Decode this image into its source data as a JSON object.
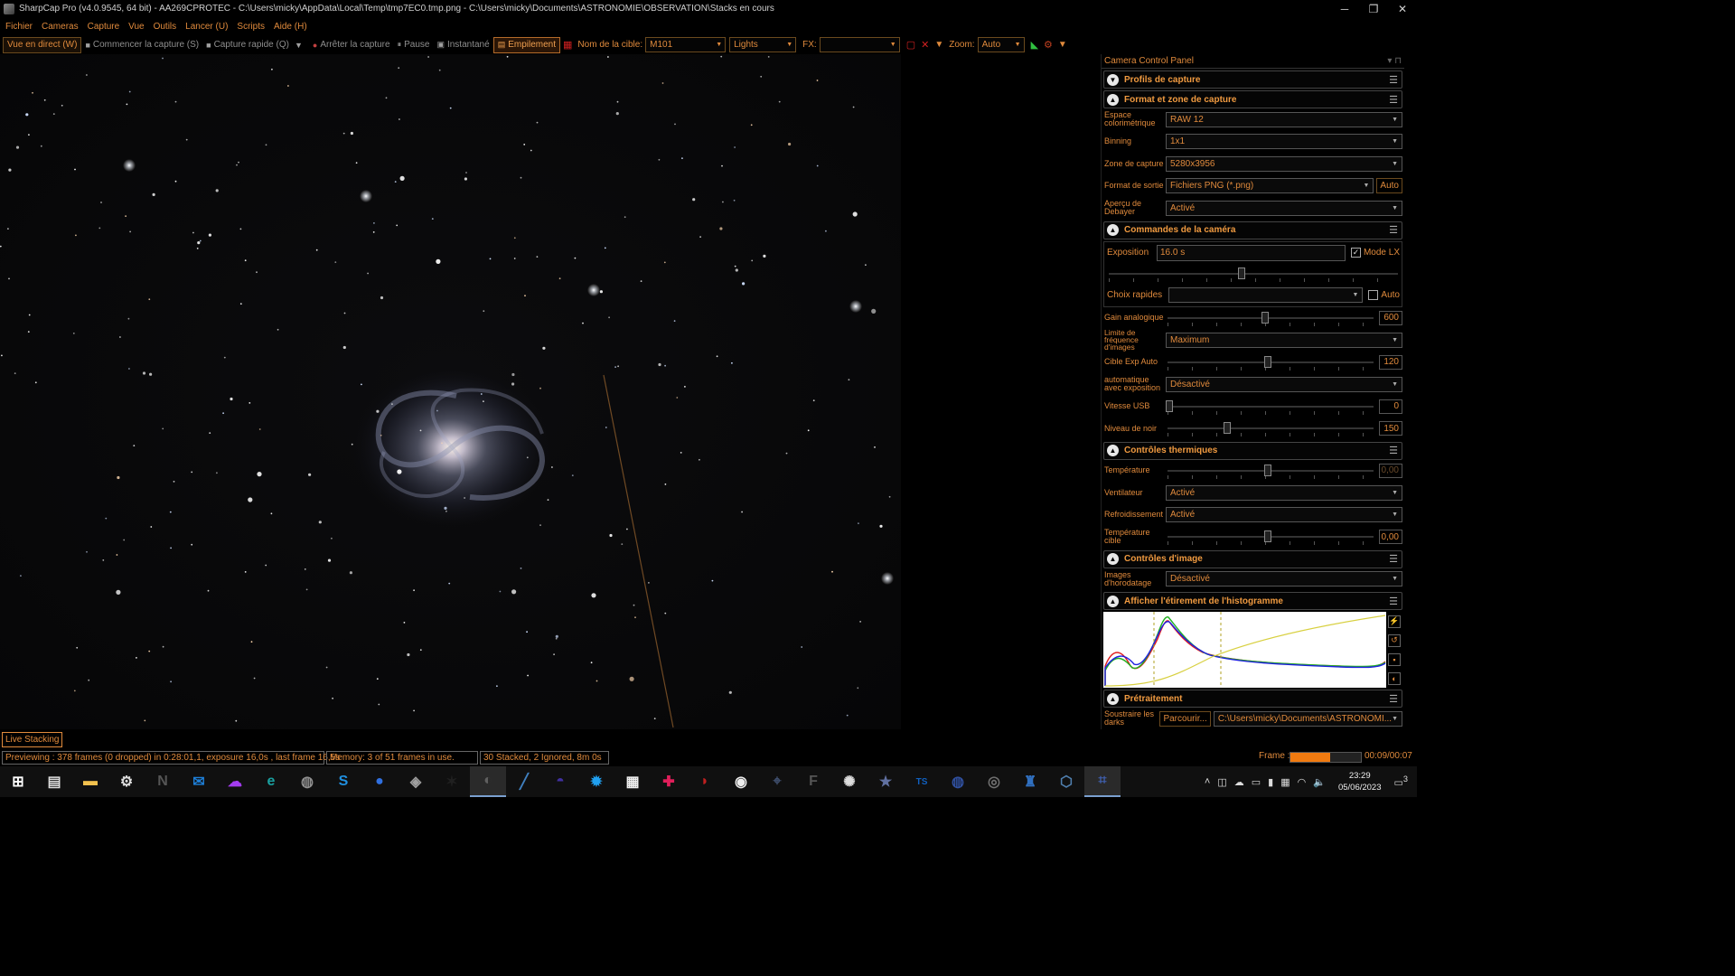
{
  "titlebar": {
    "title": "SharpCap Pro (v4.0.9545, 64 bit) - AA269CPROTEC - C:\\Users\\micky\\AppData\\Local\\Temp\\tmp7EC0.tmp.png - C:\\Users\\micky\\Documents\\ASTRONOMIE\\OBSERVATION\\Stacks en cours",
    "minimize": "─",
    "maximize": "❐",
    "close": "✕"
  },
  "menu": [
    "Fichier",
    "Cameras",
    "Capture",
    "Vue",
    "Outils",
    "Lancer (U)",
    "Scripts",
    "Aide (H)"
  ],
  "toolbar": {
    "live_view": "Vue en direct (W)",
    "start_capture": "Commencer la capture (S)",
    "quick_capture": "Capture rapide (Q)",
    "stop_capture": "Arrêter la capture",
    "pause": "Pause",
    "snapshot": "Instantané",
    "stacking": "Empilement",
    "target_label": "Nom de la cible:",
    "target_value": "M101",
    "frame_type": "Lights",
    "fx_label": "FX:",
    "fx_value": "",
    "zoom_label": "Zoom:",
    "zoom_value": "Auto"
  },
  "panel": {
    "title": "Camera Control Panel",
    "sections": {
      "profiles": "Profils de capture",
      "format": "Format et zone de capture",
      "camera": "Commandes de la caméra",
      "thermal": "Contrôles thermiques",
      "image": "Contrôles d'image",
      "histogram": "Afficher l'étirement de l'histogramme",
      "preprocessing": "Prétraitement"
    },
    "format": {
      "colorspace_label": "Espace colorimétrique",
      "colorspace_value": "RAW 12",
      "binning_label": "Binning",
      "binning_value": "1x1",
      "zone_label": "Zone de capture",
      "zone_value": "5280x3956",
      "output_label": "Format de sortie",
      "output_value": "Fichiers PNG (*.png)",
      "output_auto": "Auto",
      "debayer_label": "Aperçu de Debayer",
      "debayer_value": "Activé"
    },
    "camera": {
      "exposure_label": "Exposition",
      "exposure_value": "16.0 s",
      "lx_label": "Mode LX",
      "quick_label": "Choix rapides",
      "quick_auto": "Auto",
      "gain_label": "Gain analogique",
      "gain_value": "600",
      "fps_label": "Limite de fréquence d'images",
      "fps_value": "Maximum",
      "autoexp_label": "Cible Exp Auto",
      "autoexp_value": "120",
      "autoexp2_label": "automatique avec exposition",
      "autoexp2_value": "Désactivé",
      "usb_label": "Vitesse USB",
      "usb_value": "0",
      "black_label": "Niveau de noir",
      "black_value": "150"
    },
    "thermal": {
      "temp_label": "Température",
      "temp_value": "0,00",
      "fan_label": "Ventilateur",
      "fan_value": "Activé",
      "cooling_label": "Refroidissement",
      "cooling_value": "Activé",
      "target_label": "Température cible",
      "target_value": "0,00"
    },
    "image": {
      "timestamp_label": "Images d'horodatage",
      "timestamp_value": "Désactivé"
    },
    "preprocessing": {
      "darks_label": "Soustraire les darks",
      "browse": "Parcourir...",
      "path": "C:\\Users\\micky\\Documents\\ASTRONOMI..."
    }
  },
  "bottom": {
    "live_stacking_tab": "Live Stacking",
    "status_preview": "Previewing : 378 frames (0 dropped) in 0:28:01,1, exposure 16,0s , last frame 16,5s",
    "status_memory": "Memory: 3 of 51 frames in use.",
    "status_stack": "30 Stacked, 2 Ignored, 8m 0s",
    "frame_label": "Frame :",
    "frame_progress": 0.56,
    "frame_count": "00:09/00:07"
  },
  "taskbar": {
    "time": "23:29",
    "date": "05/06/2023",
    "notification_count": "3",
    "apps": [
      {
        "name": "windows-start",
        "color": "#ffffff",
        "glyph": "⊞"
      },
      {
        "name": "task-view",
        "color": "#dddddd",
        "glyph": "▤"
      },
      {
        "name": "file-explorer",
        "color": "#f2c14e",
        "glyph": "▬"
      },
      {
        "name": "settings",
        "color": "#dddddd",
        "glyph": "⚙"
      },
      {
        "name": "nina",
        "color": "#555555",
        "glyph": "N"
      },
      {
        "name": "mail",
        "color": "#1e7fd8",
        "glyph": "✉"
      },
      {
        "name": "messenger",
        "color": "#a33cf0",
        "glyph": "☁"
      },
      {
        "name": "edge",
        "color": "#1aa0a0",
        "glyph": "e"
      },
      {
        "name": "app-globe",
        "color": "#909090",
        "glyph": "◍"
      },
      {
        "name": "app-skype",
        "color": "#2090e0",
        "glyph": "S"
      },
      {
        "name": "app-blue-circle",
        "color": "#3070e0",
        "glyph": "●"
      },
      {
        "name": "app-db",
        "color": "#a0a0a0",
        "glyph": "◈"
      },
      {
        "name": "app-pixinsight",
        "color": "#202020",
        "glyph": "✶"
      },
      {
        "name": "sharpcap",
        "color": "#606060",
        "glyph": "◐"
      },
      {
        "name": "app-chart",
        "color": "#4080c0",
        "glyph": "╱"
      },
      {
        "name": "app-stellarium",
        "color": "#4030a0",
        "glyph": "◓"
      },
      {
        "name": "app-star",
        "color": "#20a0f0",
        "glyph": "✹"
      },
      {
        "name": "app-layout",
        "color": "#f0f0f0",
        "glyph": "▦"
      },
      {
        "name": "app-slack",
        "color": "#e01e5a",
        "glyph": "✚"
      },
      {
        "name": "app-red",
        "color": "#c02020",
        "glyph": "◗"
      },
      {
        "name": "app-obs",
        "color": "#eeeeee",
        "glyph": "◉"
      },
      {
        "name": "app-phd",
        "color": "#405070",
        "glyph": "⌖"
      },
      {
        "name": "app-f",
        "color": "#555555",
        "glyph": "F"
      },
      {
        "name": "app-siril",
        "color": "#dddddd",
        "glyph": "✺"
      },
      {
        "name": "app-star2",
        "color": "#6070a0",
        "glyph": "★"
      },
      {
        "name": "app-ts",
        "color": "#1060c0",
        "glyph": "TS"
      },
      {
        "name": "app-nasa",
        "color": "#3050a0",
        "glyph": "◍"
      },
      {
        "name": "app-cam",
        "color": "#707070",
        "glyph": "◎"
      },
      {
        "name": "app-ascom",
        "color": "#3070c0",
        "glyph": "♜"
      },
      {
        "name": "app-flow",
        "color": "#5080b0",
        "glyph": "⬡"
      },
      {
        "name": "app-grid",
        "color": "#4060b0",
        "glyph": "⌗"
      }
    ]
  },
  "colors": {
    "accent": "#e08a3c",
    "progress": "#f07a10",
    "histogram_red": "#e02020",
    "histogram_green": "#20b020",
    "histogram_blue": "#2020e0",
    "histogram_yellow": "#d8d040"
  }
}
